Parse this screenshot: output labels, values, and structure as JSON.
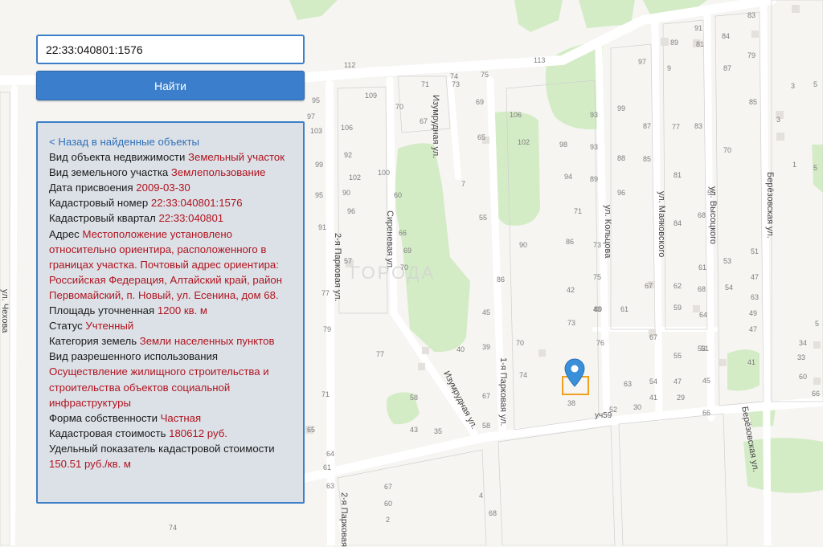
{
  "search": {
    "value": "22:33:040801:1576"
  },
  "find_button": {
    "label": "Найти"
  },
  "panel": {
    "back_link": "< Назад в найденные объекты",
    "fields": [
      {
        "label": "Вид объекта недвижимости",
        "value": "Земельный участок"
      },
      {
        "label": "Вид земельного участка",
        "value": "Землепользование"
      },
      {
        "label": "Дата присвоения",
        "value": "2009-03-30"
      },
      {
        "label": "Кадастровый номер",
        "value": "22:33:040801:1576"
      },
      {
        "label": "Кадастровый квартал",
        "value": "22:33:040801"
      },
      {
        "label": "Адрес",
        "value": "Местоположение установлено относительно ориентира, расположенного в границах участка. Почтовый адрес ориентира: Российская Федерация, Алтайский край, район Первомайский, п. Новый, ул. Есенина, дом 68."
      },
      {
        "label": "Площадь уточненная",
        "value": "1200 кв. м"
      },
      {
        "label": "Статус",
        "value": "Учтенный"
      },
      {
        "label": "Категория земель",
        "value": "Земли населенных пунктов"
      },
      {
        "label": "Вид разрешенного использования",
        "value": "Осуществление жилищного строительства и строительства объектов социальной инфраструктуры"
      },
      {
        "label": "Форма собственности",
        "value": "Частная"
      },
      {
        "label": "Кадастровая стоимость",
        "value": "180612 руб."
      },
      {
        "label": "Удельный показатель кадастровой стоимости",
        "value": "150.51 руб./кв. м"
      }
    ]
  },
  "watermark": "ГОРОДА",
  "streets": {
    "chekhova": "ул. Чехова",
    "park2": "2-я Парковая ул.",
    "park2_b": "2-я Парковая",
    "sirenevaya": "Сиреневая ул.",
    "izumrudnaya_top": "Изумрудная ул.",
    "izumrudnaya_mid": "Изумрудная ул.",
    "park1": "1-я Парковая ул.",
    "koltsova": "ул. Кольцова",
    "mayakovskogo": "ул. Маяковского",
    "vysotskogo": "ул. Высоцкого",
    "berezovskaya": "Берёзовская ул.",
    "berezovskaya_b": "Берёзовская ул.",
    "plot_label": "уч59"
  },
  "house_numbers": [
    "83",
    "91",
    "84",
    "79",
    "89",
    "81",
    "87",
    "85",
    "3",
    "5",
    "112",
    "113",
    "74",
    "75",
    "97",
    "9",
    "109",
    "71",
    "73",
    "69",
    "95",
    "70",
    "106",
    "67",
    "93",
    "99",
    "97",
    "3",
    "103",
    "65",
    "106",
    "92",
    "87",
    "83",
    "102",
    "98",
    "93",
    "70",
    "5",
    "102",
    "99",
    "96",
    "88",
    "85",
    "1",
    "95",
    "100",
    "60",
    "94",
    "89",
    "81",
    "77",
    "96",
    "90",
    "71",
    "7",
    "91",
    "55",
    "86",
    "84",
    "68",
    "66",
    "69",
    "73",
    "70",
    "57",
    "55",
    "53",
    "51",
    "47",
    "90",
    "67",
    "62",
    "61",
    "54",
    "86",
    "75",
    "77",
    "79",
    "68",
    "63",
    "49",
    "47",
    "45",
    "43",
    "42",
    "80",
    "73",
    "76",
    "67",
    "64",
    "59",
    "53",
    "5",
    "40",
    "39",
    "41",
    "71",
    "77",
    "74",
    "70",
    "61",
    "55",
    "51",
    "54",
    "47",
    "45",
    "34",
    "33",
    "60",
    "58",
    "67",
    "63",
    "52",
    "41",
    "30",
    "29",
    "66",
    "66",
    "43",
    "35",
    "58",
    "38",
    "65",
    "64",
    "67",
    "61",
    "63",
    "60",
    "2",
    "4",
    "68",
    "74"
  ],
  "colors": {
    "panel_border": "#3d7fc8",
    "button": "#3b7ecb",
    "value_text": "#b0131f",
    "link": "#2f6fb8",
    "green_area": "#d4ecc6",
    "road": "#ffffff",
    "marker": "#3a8fd9",
    "plot_outline": "#f0a020"
  },
  "icons": {
    "marker": "map-pin-icon"
  }
}
